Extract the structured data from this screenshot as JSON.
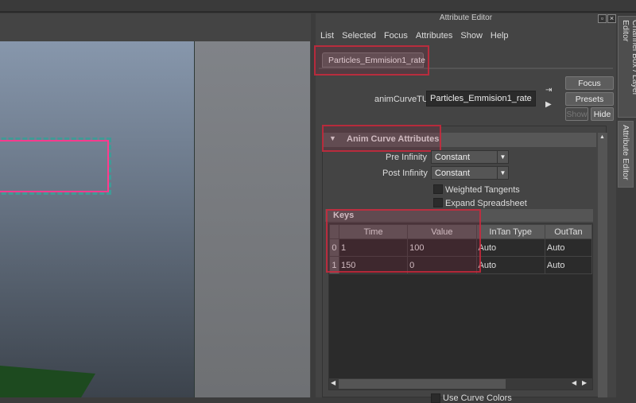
{
  "window": {
    "title": "Attribute Editor"
  },
  "menu": [
    "List",
    "Selected",
    "Focus",
    "Attributes",
    "Show",
    "Help"
  ],
  "node_tab": "Particles_Emmision1_rate",
  "node": {
    "label": "animCurveTU:",
    "value": "Particles_Emmision1_rate"
  },
  "buttons": {
    "focus": "Focus",
    "presets": "Presets",
    "show": "Show",
    "hide": "Hide"
  },
  "section": {
    "title": "Anim Curve Attributes",
    "pre_infinity": {
      "label": "Pre Infinity",
      "value": "Constant"
    },
    "post_infinity": {
      "label": "Post Infinity",
      "value": "Constant"
    },
    "weighted_tangents": {
      "label": "Weighted Tangents",
      "checked": false
    },
    "expand_spreadsheet": {
      "label": "Expand Spreadsheet",
      "checked": false
    }
  },
  "keys": {
    "title": "Keys",
    "columns": [
      "Time",
      "Value",
      "InTan Type",
      "OutTan"
    ],
    "rows": [
      {
        "index": "0",
        "cells": [
          "1",
          "100",
          "Auto",
          "Auto"
        ]
      },
      {
        "index": "1",
        "cells": [
          "150",
          "0",
          "Auto",
          "Auto"
        ]
      }
    ]
  },
  "bottom_checkbox": "Use Curve Colors",
  "side_tabs": {
    "channel_box": "Channel Box / Layer Editor",
    "attribute_editor": "Attribute Editor"
  },
  "colors": {
    "highlight": "#d2283c",
    "selection": "#ff3b8e",
    "panel": "#444444"
  }
}
